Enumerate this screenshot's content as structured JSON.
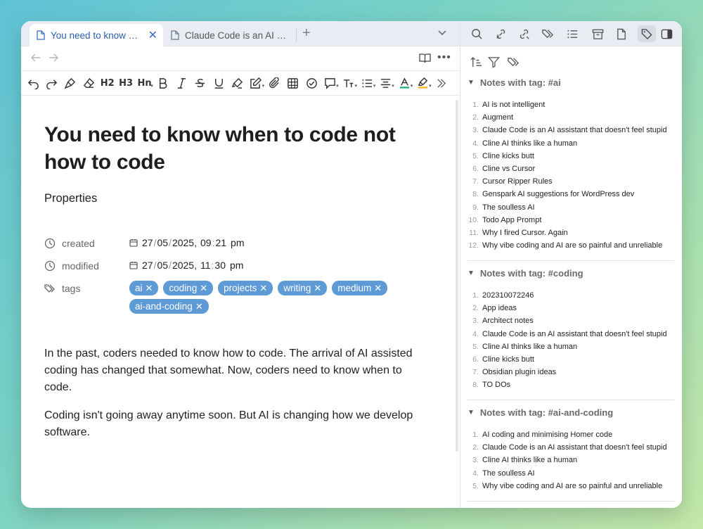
{
  "tabs": [
    {
      "label": "You need to know when to code not how to code",
      "active": true,
      "close": "✕"
    },
    {
      "label": "Claude Code is an AI assistant that doesn't feel stupid",
      "active": false
    }
  ],
  "new_tab": "+",
  "toolbar": {
    "h2": "H2",
    "h3": "H3",
    "hn": "Hn"
  },
  "note": {
    "title": "You need to know when to code not how to code",
    "properties_heading": "Properties",
    "created": {
      "label": "created",
      "date": [
        "27",
        "05",
        "2025"
      ],
      "time": [
        "09",
        "21"
      ],
      "ampm": "pm"
    },
    "modified": {
      "label": "modified",
      "date": [
        "27",
        "05",
        "2025"
      ],
      "time": [
        "11",
        "30"
      ],
      "ampm": "pm"
    },
    "tags_label": "tags",
    "tags": [
      "ai",
      "coding",
      "projects",
      "writing",
      "medium",
      "ai-and-coding"
    ],
    "paragraphs": [
      "In the past, coders needed to know how to code. The arrival of AI assisted coding has changed that somewhat. Now, coders need to know when to code.",
      "Coding isn't going away anytime soon. But AI is changing how we develop software."
    ]
  },
  "sidebar": {
    "sections": [
      {
        "heading": "Notes with tag: #ai",
        "items": [
          "AI is not intelligent",
          "Augment",
          "Claude Code is an AI assistant that doesn't feel stupid",
          "Cline AI thinks like a human",
          "Cline kicks butt",
          "Cline vs Cursor",
          "Cursor Ripper Rules",
          "Genspark AI suggestions for WordPress dev",
          "The soulless AI",
          "Todo App Prompt",
          "Why I fired Cursor. Again",
          "Why vibe coding and AI are so painful and unreliable"
        ]
      },
      {
        "heading": "Notes with tag: #coding",
        "items": [
          "202310072246",
          "App ideas",
          "Architect notes",
          "Claude Code is an AI assistant that doesn't feel stupid",
          "Cline AI thinks like a human",
          "Cline kicks butt",
          "Obsidian plugin ideas",
          "TO DOs"
        ]
      },
      {
        "heading": "Notes with tag: #ai-and-coding",
        "items": [
          "AI coding and minimising Homer code",
          "Claude Code is an AI assistant that doesn't feel stupid",
          "Cline AI thinks like a human",
          "The soulless AI",
          "Why vibe coding and AI are so painful and unreliable"
        ]
      }
    ]
  },
  "colors": {
    "tag_bg": "#5e9bd6",
    "accent": "#2a5fb0",
    "highlight_a": "#20b26b",
    "highlight_b": "#f2b824"
  }
}
